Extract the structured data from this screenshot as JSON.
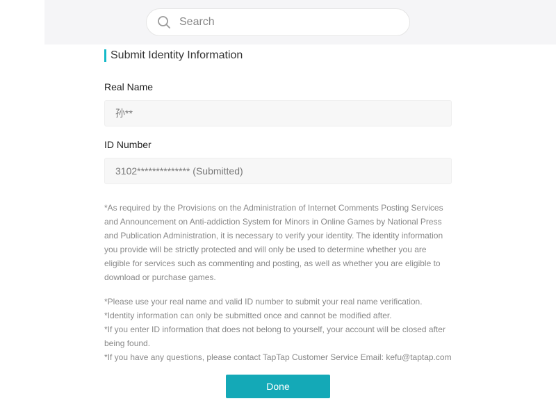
{
  "search": {
    "placeholder": "Search",
    "icon": "search-icon"
  },
  "form": {
    "title": "Submit Identity Information",
    "accent_color": "#14b9c8",
    "real_name": {
      "label": "Real Name",
      "value": "孙**"
    },
    "id_number": {
      "label": "ID Number",
      "value": "3102************** (Submitted)"
    },
    "notice": "*As required by the Provisions on the Administration of Internet Comments Posting Services and Announcement on Anti-addiction System for Minors in Online Games by National Press and Publication Administration, it is necessary to verify your identity. The identity information you provide will be strictly protected and will only be used to determine whether you are eligible for services such as commenting and posting, as well as whether you are eligible to download or purchase games.",
    "notes": [
      "*Please use your real name and valid ID number to submit your real name verification.",
      "*Identity information can only be submitted once and cannot be modified after.",
      "*If you enter ID information that does not belong to yourself, your account will be closed after being found.",
      "*If you have any questions, please contact TapTap Customer Service Email: kefu@taptap.com"
    ],
    "done_label": "Done",
    "done_color": "#14a9b7"
  }
}
